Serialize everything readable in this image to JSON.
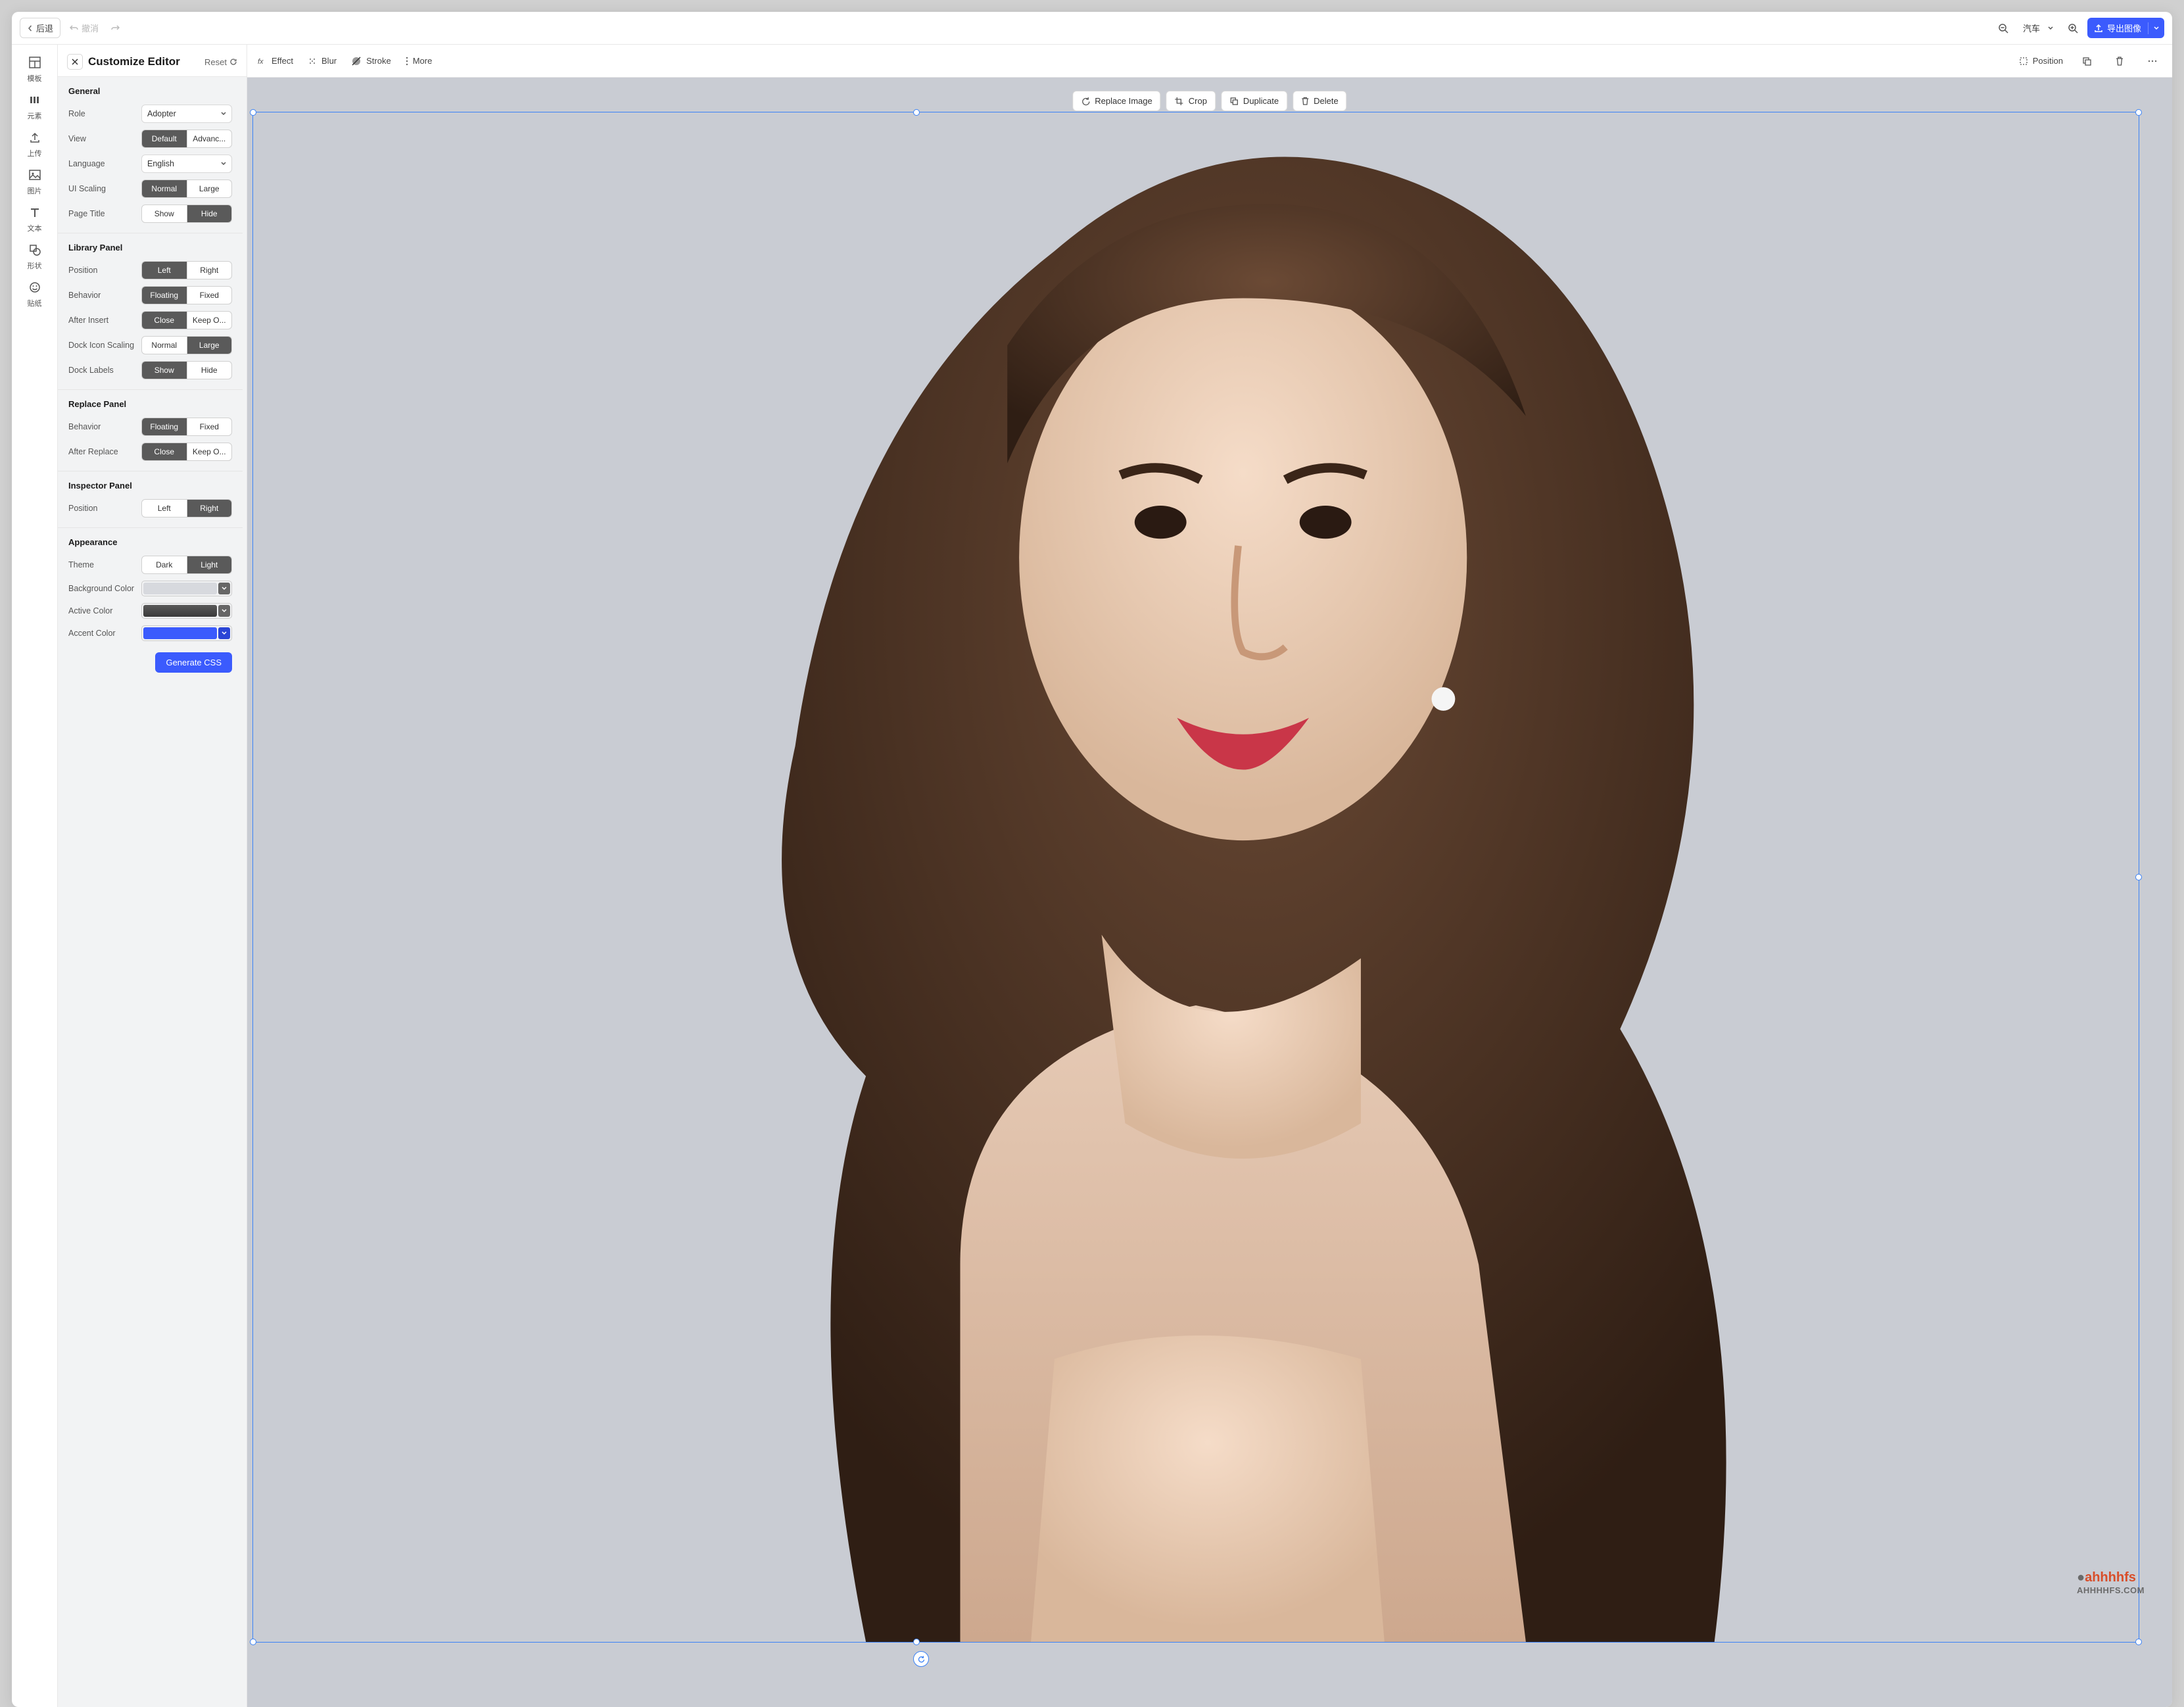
{
  "topbar": {
    "back": "后退",
    "undo": "撤消",
    "zoom_label": "汽车",
    "export": "导出图像"
  },
  "dock": {
    "template": "模板",
    "elements": "元素",
    "upload": "上传",
    "image": "图片",
    "text": "文本",
    "shape": "形状",
    "sticker": "贴纸"
  },
  "panel": {
    "title": "Customize Editor",
    "reset": "Reset",
    "general": {
      "heading": "General",
      "role_label": "Role",
      "role_value": "Adopter",
      "view_label": "View",
      "view_opt1": "Default",
      "view_opt2": "Advanc...",
      "lang_label": "Language",
      "lang_value": "English",
      "scaling_label": "UI Scaling",
      "scaling_opt1": "Normal",
      "scaling_opt2": "Large",
      "pagetitle_label": "Page Title",
      "pagetitle_opt1": "Show",
      "pagetitle_opt2": "Hide"
    },
    "library": {
      "heading": "Library Panel",
      "position_label": "Position",
      "position_opt1": "Left",
      "position_opt2": "Right",
      "behavior_label": "Behavior",
      "behavior_opt1": "Floating",
      "behavior_opt2": "Fixed",
      "after_insert_label": "After Insert",
      "after_insert_opt1": "Close",
      "after_insert_opt2": "Keep O...",
      "dock_scaling_label": "Dock Icon Scaling",
      "dock_scaling_opt1": "Normal",
      "dock_scaling_opt2": "Large",
      "dock_labels_label": "Dock Labels",
      "dock_labels_opt1": "Show",
      "dock_labels_opt2": "Hide"
    },
    "replace": {
      "heading": "Replace Panel",
      "behavior_label": "Behavior",
      "behavior_opt1": "Floating",
      "behavior_opt2": "Fixed",
      "after_replace_label": "After Replace",
      "after_replace_opt1": "Close",
      "after_replace_opt2": "Keep O..."
    },
    "inspector": {
      "heading": "Inspector Panel",
      "position_label": "Position",
      "position_opt1": "Left",
      "position_opt2": "Right"
    },
    "appearance": {
      "heading": "Appearance",
      "theme_label": "Theme",
      "theme_opt1": "Dark",
      "theme_opt2": "Light",
      "bg_label": "Background Color",
      "bg_color": "#d7d9de",
      "active_label": "Active Color",
      "active_color": "#4e4e4e",
      "accent_label": "Accent Color",
      "accent_color": "#3b5bfd",
      "generate": "Generate CSS"
    }
  },
  "toolbar": {
    "effect": "Effect",
    "blur": "Blur",
    "stroke": "Stroke",
    "more": "More",
    "position": "Position"
  },
  "context": {
    "replace": "Replace Image",
    "crop": "Crop",
    "duplicate": "Duplicate",
    "delete": "Delete"
  },
  "watermark": {
    "line1": "ahhhhfs",
    "line2": "AHHHHFS.COM"
  }
}
